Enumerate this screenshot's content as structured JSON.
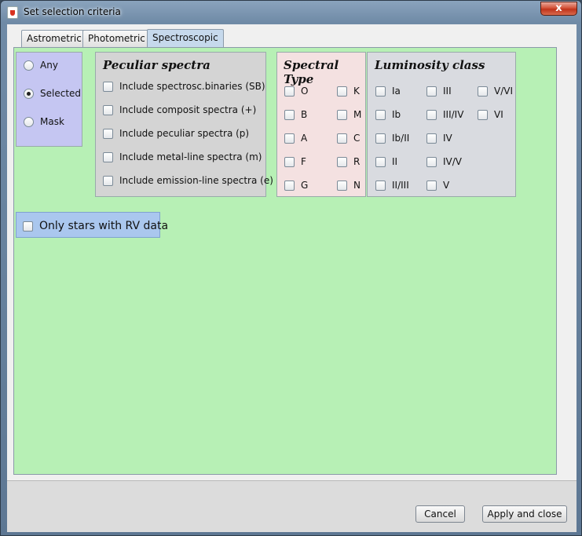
{
  "window": {
    "title": "Set selection criteria",
    "close_symbol": "x"
  },
  "tabs": [
    {
      "label": "Astrometric",
      "active": false
    },
    {
      "label": "Photometric",
      "active": false
    },
    {
      "label": "Spectroscopic",
      "active": true
    }
  ],
  "mode": {
    "options": [
      {
        "label": "Any",
        "checked": false
      },
      {
        "label": "Selected",
        "checked": true
      },
      {
        "label": "Mask",
        "checked": false
      }
    ]
  },
  "peculiar": {
    "title": "Peculiar spectra",
    "items": [
      {
        "label": "Include spectrosc.binaries (SB)",
        "checked": false
      },
      {
        "label": "Include composit spectra (+)",
        "checked": false
      },
      {
        "label": "Include peculiar spectra (p)",
        "checked": false
      },
      {
        "label": "Include metal-line spectra (m)",
        "checked": false
      },
      {
        "label": "Include emission-line spectra (e)",
        "checked": false
      }
    ]
  },
  "spectral_type": {
    "title": "Spectral Type",
    "items": [
      "O",
      "B",
      "A",
      "F",
      "G",
      "K",
      "M",
      "C",
      "R",
      "N"
    ]
  },
  "luminosity": {
    "title": "Luminosity class",
    "items": [
      "Ia",
      "Ib",
      "Ib/II",
      "II",
      "II/III",
      "III",
      "III/IV",
      "IV",
      "IV/V",
      "V",
      "V/VI",
      "VI"
    ]
  },
  "rv": {
    "label": "Only stars with RV data",
    "checked": false
  },
  "buttons": {
    "cancel": "Cancel",
    "apply": "Apply and close"
  },
  "colors": {
    "panel_bg": "#b7f0b5",
    "mode_bg": "#c5c6f2",
    "peculiar_bg": "#d4d4d4",
    "spectral_bg": "#f4e1e1",
    "luminosity_bg": "#d9dbe0",
    "rv_bg": "#aac7ee",
    "active_tab": "#c6d9ec"
  }
}
